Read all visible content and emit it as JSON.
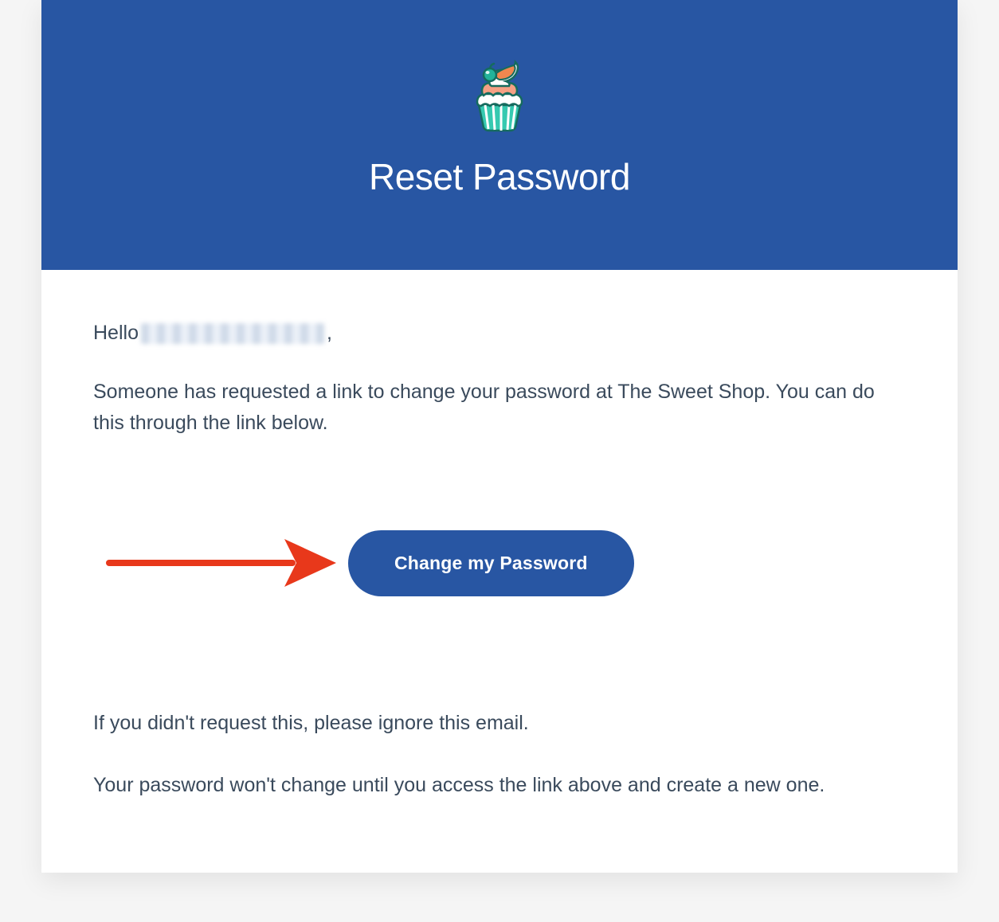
{
  "header": {
    "title": "Reset Password"
  },
  "body": {
    "greeting_prefix": "Hello ",
    "greeting_suffix": ",",
    "request_text": "Someone has requested a link to change your password at The Sweet Shop. You can do this through the link below.",
    "ignore_text": "If you didn't request this, please ignore this email.",
    "no_change_text": "Your password won't change until you access the link above and create a new one."
  },
  "cta": {
    "label": "Change my Password"
  },
  "annotation": {
    "arrow_color": "#e8381b"
  }
}
